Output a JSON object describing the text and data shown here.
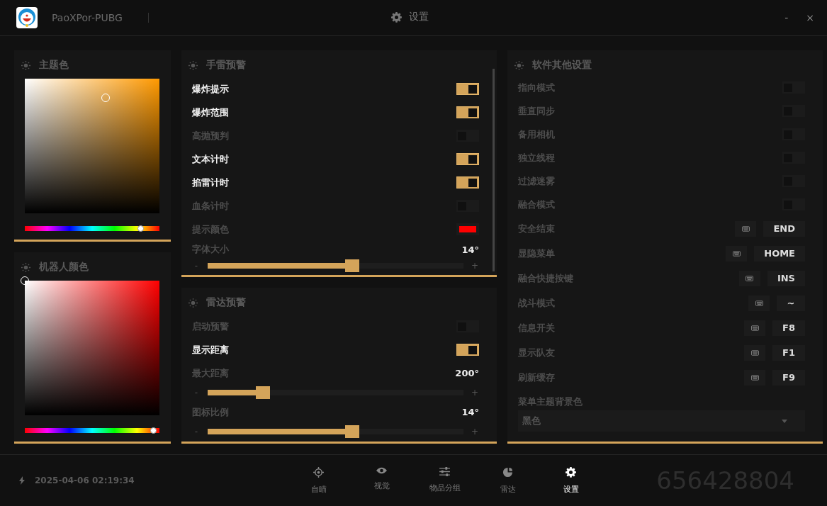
{
  "window": {
    "app_name": "PaoXPor-PUBG",
    "title": "设置",
    "minimize": "-",
    "close": "×"
  },
  "pickers": [
    {
      "title": "主题色",
      "color": "#dba758",
      "level": 0.9
    },
    {
      "title": "机器人颜色",
      "color": "#ffffff",
      "level": 1.0
    }
  ],
  "panels": [
    {
      "title": "手雷预警",
      "scrollable": true,
      "rows": [
        {
          "kind": "toggle",
          "label": "爆炸提示",
          "on": true
        },
        {
          "kind": "toggle",
          "label": "爆炸范围",
          "on": true
        },
        {
          "kind": "toggle",
          "label": "高抛预判",
          "on": false
        },
        {
          "kind": "toggle",
          "label": "文本计时",
          "on": true
        },
        {
          "kind": "toggle",
          "label": "掐雷计时",
          "on": true
        },
        {
          "kind": "toggle",
          "label": "血条计时",
          "on": false
        },
        {
          "kind": "color",
          "label": "提示颜色",
          "color": "#ff0000"
        },
        {
          "kind": "slider",
          "label": "字体大小",
          "value": "14°",
          "minus": "-",
          "plus": "+",
          "level": 0.57
        }
      ]
    },
    {
      "title": "雷达预警",
      "scrollable": false,
      "rows": [
        {
          "kind": "toggle",
          "label": "启动预警",
          "on": false
        },
        {
          "kind": "toggle",
          "label": "显示距离",
          "on": true
        },
        {
          "kind": "slider",
          "label": "最大距离",
          "value": "200°",
          "minus": "-",
          "plus": "+",
          "level": 0.2
        },
        {
          "kind": "slider",
          "label": "图标比例",
          "value": "14°",
          "minus": "-",
          "plus": "+",
          "level": 0.57
        }
      ]
    }
  ],
  "other_settings": {
    "title": "软件其他设置",
    "rows": [
      {
        "kind": "toggle",
        "label": "指向模式",
        "on": false
      },
      {
        "kind": "toggle",
        "label": "垂直同步",
        "on": false
      },
      {
        "kind": "toggle",
        "label": "备用相机",
        "on": false
      },
      {
        "kind": "toggle",
        "label": "独立线程",
        "on": false
      },
      {
        "kind": "toggle",
        "label": "过滤迷雾",
        "on": false
      },
      {
        "kind": "toggle",
        "label": "融合模式",
        "on": false
      },
      {
        "kind": "hotkey",
        "label": "安全结束",
        "key": "END"
      },
      {
        "kind": "hotkey",
        "label": "显隐菜单",
        "key": "HOME"
      },
      {
        "kind": "hotkey",
        "label": "融合快捷按键",
        "key": "INS"
      },
      {
        "kind": "hotkey",
        "label": "战斗模式",
        "key": "~"
      },
      {
        "kind": "hotkey",
        "label": "信息开关",
        "key": "F8"
      },
      {
        "kind": "hotkey",
        "label": "显示队友",
        "key": "F1"
      },
      {
        "kind": "hotkey",
        "label": "刷新缓存",
        "key": "F9"
      }
    ],
    "dropdown": {
      "label": "菜单主题背景色",
      "value": "黑色"
    }
  },
  "footer": {
    "datetime": "2025-04-06 02:19:34",
    "nav": [
      {
        "kind": "target",
        "label": "自瞄",
        "selected": false
      },
      {
        "kind": "eye",
        "label": "视觉",
        "selected": false
      },
      {
        "kind": "sliders",
        "label": "物品分组",
        "selected": false
      },
      {
        "kind": "radar",
        "label": "雷达",
        "selected": false
      },
      {
        "kind": "gear",
        "label": "设置",
        "selected": true
      }
    ],
    "number": "656428804"
  }
}
